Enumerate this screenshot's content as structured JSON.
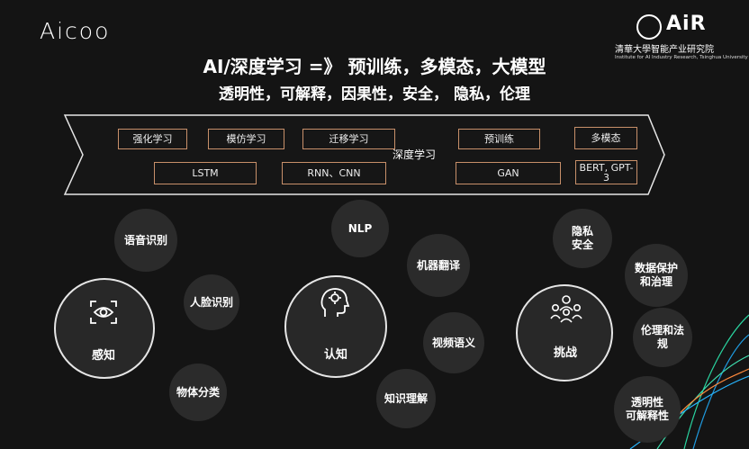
{
  "logos": {
    "left": "Aicoo",
    "right": "AiR",
    "institute_cn": "清華大學智能产业研究院",
    "institute_en": "Institute for AI Industry Research, Tsinghua University"
  },
  "title": {
    "line1": "AI/深度学习 =》 预训练，多模态，大模型",
    "line2": "透明性，可解释，因果性，安全， 隐私，伦理"
  },
  "banner": {
    "center": "深度学习",
    "boxes": {
      "rl": "强化学习",
      "imitation": "模仿学习",
      "transfer": "迁移学习",
      "pretrain": "预训练",
      "multimodal": "多模态",
      "lstm": "LSTM",
      "rnn_cnn": "RNN、CNN",
      "gan": "GAN",
      "bert": "BERT, GPT-3"
    }
  },
  "perception": {
    "label": "感知",
    "items": {
      "speech": "语音识别",
      "face": "人脸识别",
      "object": "物体分类"
    }
  },
  "cognition": {
    "label": "认知",
    "items": {
      "nlp": "NLP",
      "mt": "机器翻译",
      "video": "视频语义",
      "knowledge": "知识理解"
    }
  },
  "challenge": {
    "label": "挑战",
    "items": {
      "privacy": "隐私\n安全",
      "data": "数据保护\n和治理",
      "ethics": "伦理和法\n规",
      "transparency": "透明性\n可解释性"
    }
  },
  "icons": {
    "perception": "eye-scan-icon",
    "cognition": "brain-head-icon",
    "challenge": "team-icon"
  },
  "colors": {
    "background": "#141414",
    "box_border": "#c8906a",
    "circle": "#2b2b2b",
    "accent_lines": "#2ad4a0"
  }
}
